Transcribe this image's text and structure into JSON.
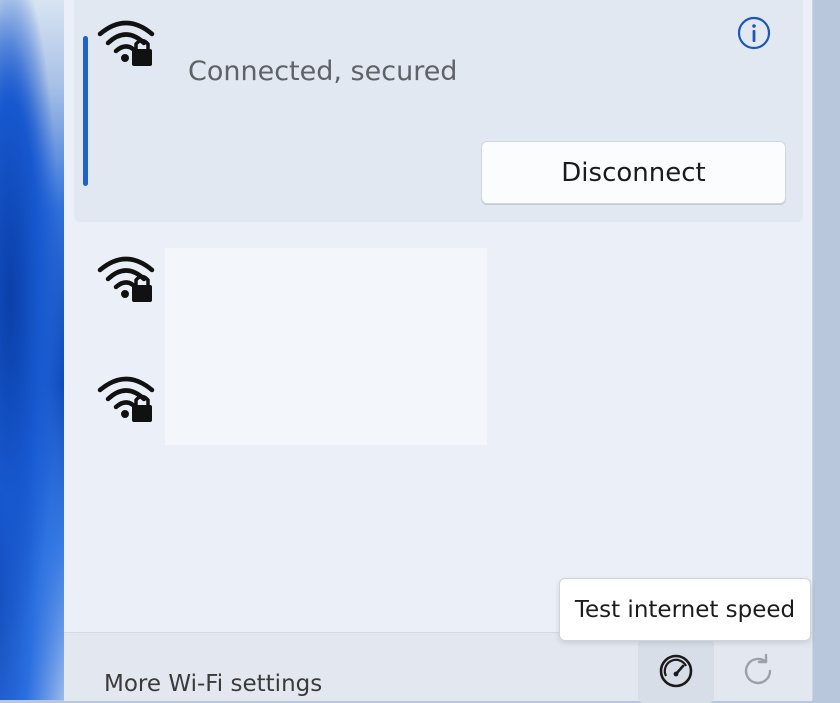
{
  "connected_network": {
    "status": "Connected, secured",
    "disconnect_label": "Disconnect",
    "icon": "wifi-secured-icon",
    "info_icon": "info-icon"
  },
  "other_networks": [
    {
      "icon": "wifi-secured-icon"
    },
    {
      "icon": "wifi-secured-icon"
    }
  ],
  "footer": {
    "more_settings_label": "More Wi-Fi settings",
    "speed_icon": "speedometer-icon",
    "refresh_icon": "refresh-icon"
  },
  "tooltip": {
    "text": "Test internet speed"
  },
  "colors": {
    "accent": "#1f63c7",
    "panel_bg": "#ebf0f8",
    "card_bg": "#e2e8f2"
  }
}
